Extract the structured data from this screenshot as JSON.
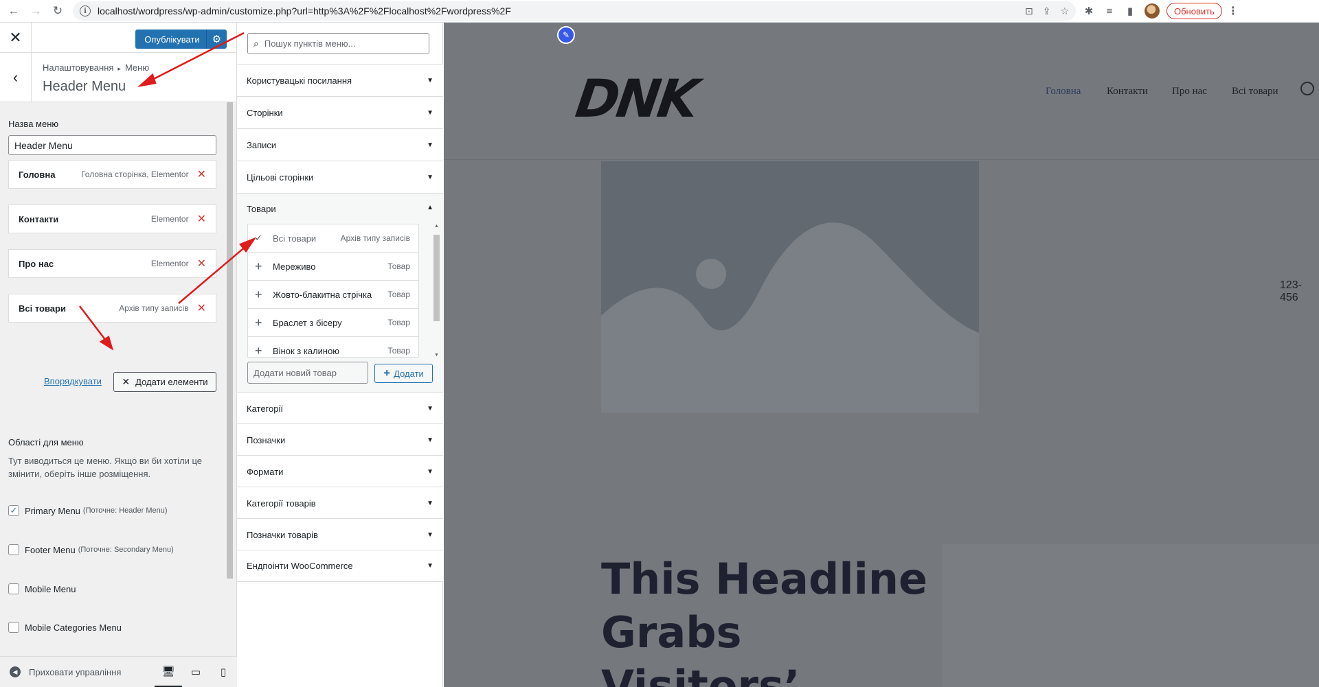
{
  "browser": {
    "url": "localhost/wordpress/wp-admin/customize.php?url=http%3A%2F%2Flocalhost%2Fwordpress%2F",
    "update_label": "Обновить"
  },
  "customizer": {
    "publish_label": "Опублікувати",
    "breadcrumb_root": "Налаштовування",
    "breadcrumb_section": "Меню",
    "section_title": "Header Menu",
    "menu_name_label": "Назва меню",
    "menu_name_value": "Header Menu",
    "menu_items": [
      {
        "title": "Головна",
        "type": "Головна сторінка, Elementor"
      },
      {
        "title": "Контакти",
        "type": "Elementor"
      },
      {
        "title": "Про нас",
        "type": "Elementor"
      },
      {
        "title": "Всі товари",
        "type": "Архів типу записів"
      }
    ],
    "reorder_label": "Впорядкувати",
    "add_items_label": "Додати елементи",
    "areas_title": "Області для меню",
    "areas_desc": "Тут виводиться це меню. Якщо ви би хотіли це змінити, оберіть інше розміщення.",
    "locations": [
      {
        "name": "Primary Menu",
        "current": "(Поточне: Header Menu)",
        "checked": true
      },
      {
        "name": "Footer Menu",
        "current": "(Поточне: Secondary Menu)",
        "checked": false
      },
      {
        "name": "Mobile Menu",
        "current": "",
        "checked": false
      },
      {
        "name": "Mobile Categories Menu",
        "current": "",
        "checked": false
      }
    ],
    "hide_controls_label": "Приховати управління"
  },
  "available": {
    "search_placeholder": "Пошук пунктів меню...",
    "sections": [
      "Користувацькі посилання",
      "Сторінки",
      "Записи",
      "Цільові сторінки",
      "Товари",
      "Категорії",
      "Позначки",
      "Формати",
      "Категорії товарів",
      "Позначки товарів",
      "Ендпоінти WooCommerce"
    ],
    "products": [
      {
        "name": "Всі товари",
        "type": "Архів типу записів",
        "added": true
      },
      {
        "name": "Мереживо",
        "type": "Товар",
        "added": false
      },
      {
        "name": "Жовто-блакитна стрічка",
        "type": "Товар",
        "added": false
      },
      {
        "name": "Браслет з бісеру",
        "type": "Товар",
        "added": false
      },
      {
        "name": "Вінок з калиною",
        "type": "Товар",
        "added": false
      }
    ],
    "new_product_placeholder": "Додати новий товар",
    "add_product_label": "Додати"
  },
  "preview": {
    "logo": "DNK",
    "nav": [
      "Головна",
      "Контакти",
      "Про нас",
      "Всі товари"
    ],
    "phone": "123-456",
    "headline": "This Headline Grabs Visitors’"
  },
  "colors": {
    "accent": "#2271b1",
    "delete": "#d63638",
    "annotation": "#e01b1b"
  }
}
